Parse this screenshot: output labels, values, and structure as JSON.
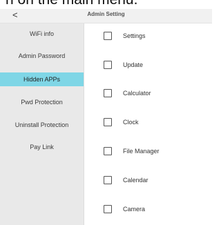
{
  "caption": "n on the main menu.",
  "header": {
    "back_icon": "<",
    "title": "Admin Setting"
  },
  "sidebar": {
    "items": [
      {
        "label": "WiFi info",
        "active": false
      },
      {
        "label": "Admin Password",
        "active": false
      },
      {
        "label": "Hidden APPs",
        "active": true
      },
      {
        "label": "Pwd Protection",
        "active": false
      },
      {
        "label": "Uninstall Protection",
        "active": false
      },
      {
        "label": "Pay Link",
        "active": false
      }
    ]
  },
  "apps": [
    {
      "label": "Settings",
      "checked": false
    },
    {
      "label": "Update",
      "checked": false
    },
    {
      "label": "Calculator",
      "checked": false
    },
    {
      "label": "Clock",
      "checked": false
    },
    {
      "label": "File Manager",
      "checked": false
    },
    {
      "label": "Calendar",
      "checked": false
    },
    {
      "label": "Camera",
      "checked": false
    }
  ],
  "colors": {
    "active_highlight": "#7fd6e6",
    "sidebar_bg": "#e9e9e9",
    "title_bar_bg": "#f1f1f1"
  }
}
